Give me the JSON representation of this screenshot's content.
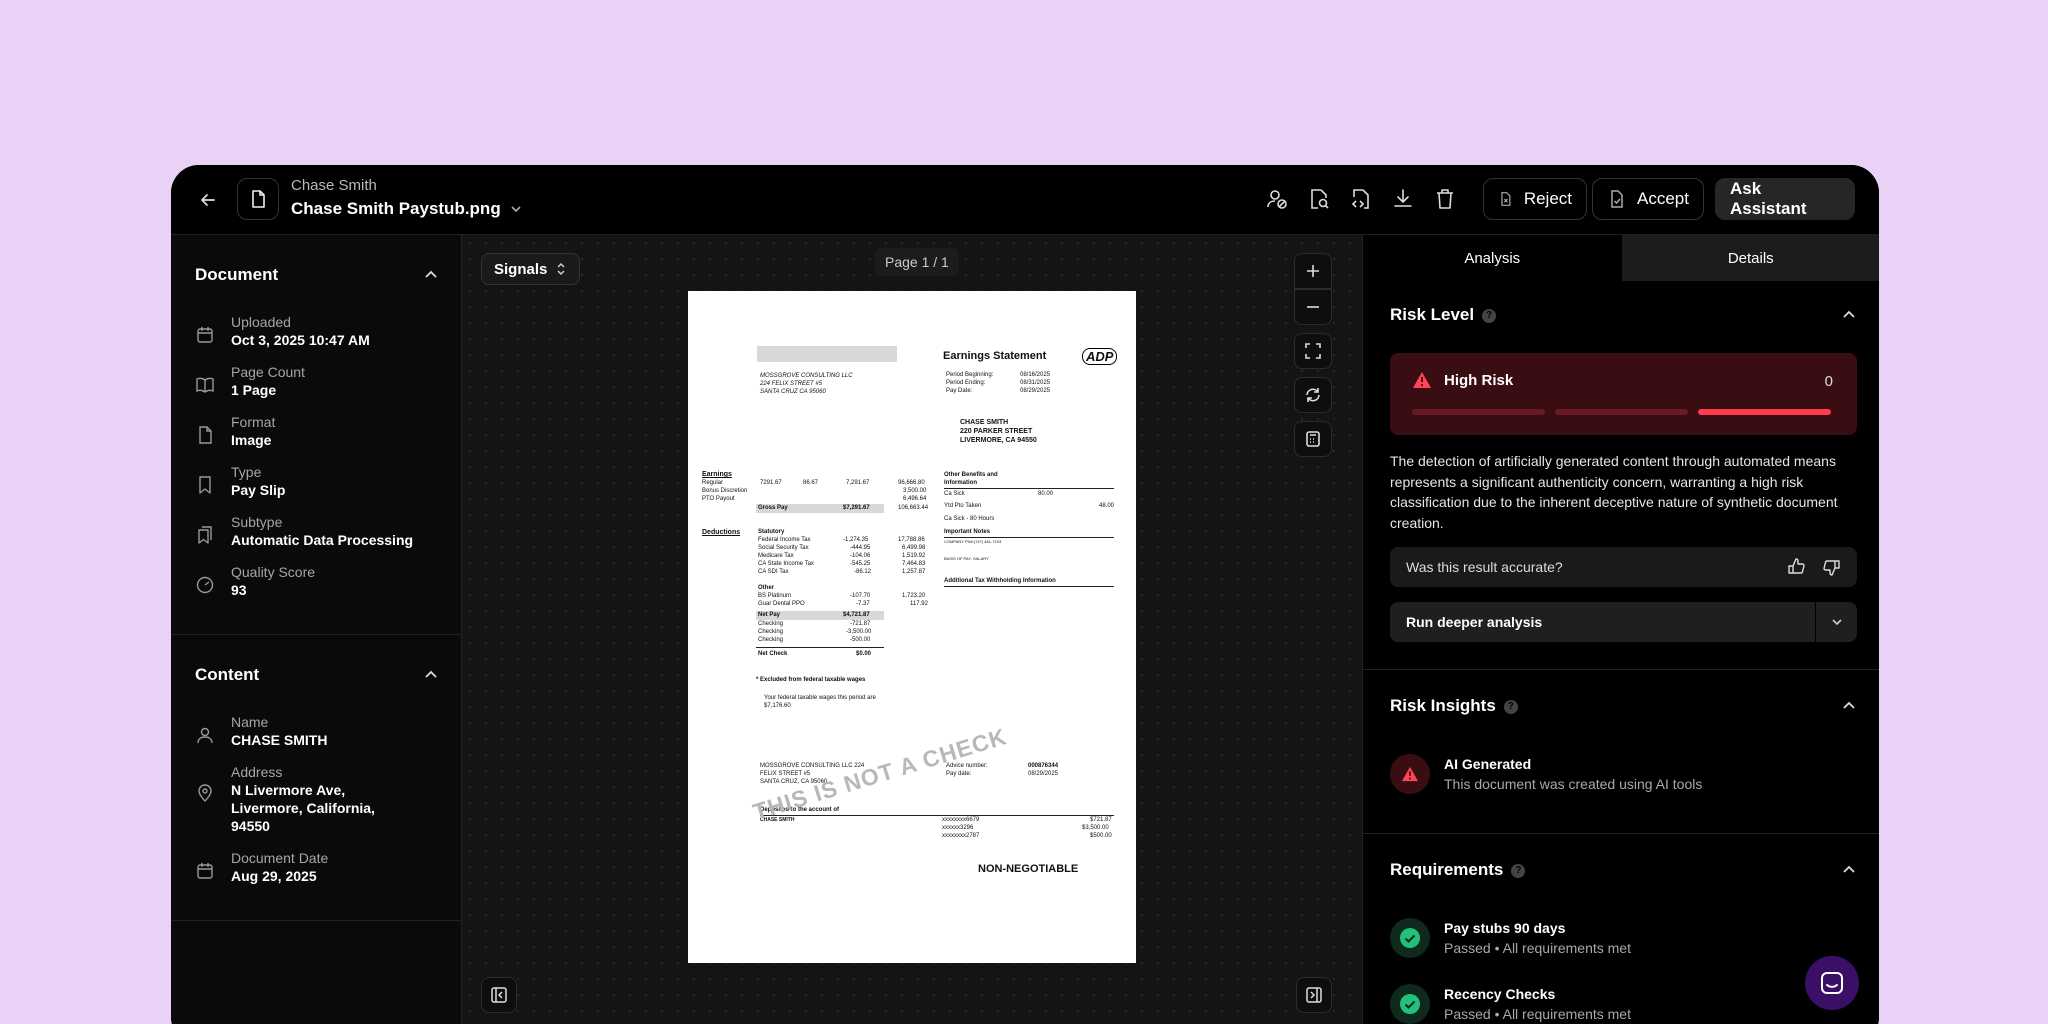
{
  "header": {
    "owner": "Chase Smith",
    "filename": "Chase Smith Paystub.png",
    "reject_label": "Reject",
    "accept_label": "Accept",
    "ask_label": "Ask Assistant"
  },
  "sidebar": {
    "document_title": "Document",
    "document_items": [
      {
        "label": "Uploaded",
        "value": "Oct 3, 2025 10:47 AM",
        "icon": "calendar-icon"
      },
      {
        "label": "Page Count",
        "value": "1 Page",
        "icon": "book-icon"
      },
      {
        "label": "Format",
        "value": "Image",
        "icon": "file-icon"
      },
      {
        "label": "Type",
        "value": "Pay Slip",
        "icon": "bookmark-icon"
      },
      {
        "label": "Subtype",
        "value": "Automatic Data Processing",
        "icon": "bookmarks-icon"
      },
      {
        "label": "Quality Score",
        "value": "93",
        "icon": "gauge-icon"
      }
    ],
    "content_title": "Content",
    "content_items": [
      {
        "label": "Name",
        "value": "CHASE SMITH",
        "icon": "user-icon"
      },
      {
        "label": "Address",
        "value": "N Livermore Ave, Livermore, California, 94550",
        "icon": "location-icon"
      },
      {
        "label": "Document Date",
        "value": "Aug 29, 2025",
        "icon": "calendar-icon"
      }
    ]
  },
  "viewer": {
    "signals_label": "Signals",
    "page_indicator": "Page 1 / 1"
  },
  "paper": {
    "title": "Earnings Statement",
    "logo": "ADP",
    "company": "MOSSGROVE  CONSULTING  LLC",
    "company_addr1": "224 FELIX  STREET  #5",
    "company_addr2": "SANTA  CRUZ  CA 95060",
    "period_begin_label": "Period Beginning:",
    "period_begin": "08/16/2025",
    "period_end_label": "Period Ending:",
    "period_end": "08/31/2025",
    "pay_date_label": "Pay Date:",
    "pay_date": "08/29/2025",
    "emp_name": "CHASE  SMITH",
    "emp_addr1": "220  PARKER  STREET",
    "emp_addr2": "LIVERMORE,  CA  94550",
    "earnings": "Earnings",
    "regular": "Regular",
    "regular_rate": "7291.67",
    "regular_hours": "86.67",
    "regular_amt": "7,291.67",
    "bonus": "Bonus Discretion",
    "pto": "PTO Payout",
    "ytd1": "96,666.80",
    "ytd2": "3,500.00",
    "ytd3": "6,496.64",
    "gross_pay": "Gross Pay",
    "gross_amt": "$7,291.67",
    "gross_ytd": "106,663.44",
    "deductions": "Deductions",
    "statutory": "Statutory",
    "fed_tax": "Federal Income Tax",
    "fed_amt": "-1,274.35",
    "fed_ytd": "17,788.86",
    "ss_tax": "Social Security Tax",
    "ss_amt": "-444.95",
    "ss_ytd": "6,499.98",
    "med_tax": "Medicare Tax",
    "med_amt": "-104.06",
    "med_ytd": "1,519.92",
    "ca_tax": "CA State Income Tax",
    "ca_amt": "-545.25",
    "ca_ytd": "7,464.83",
    "sdi_tax": "CA SDI Tax",
    "sdi_amt": "-86.12",
    "sdi_ytd": "1,257.87",
    "other": "Other",
    "bs": "BS Platinum",
    "bs_amt": "-107.70",
    "bs_ytd": "1,723.20",
    "dental": "Guar Dental PPO",
    "dental_amt": "-7.37",
    "dental_ytd": "117.92",
    "net_pay": "Net Pay",
    "net_amt": "$4,721.87",
    "checking": "Checking",
    "chk1": "-721.87",
    "chk2": "-3,500.00",
    "chk3": "-500.00",
    "net_check": "Net Check",
    "net_check_amt": "$0.00",
    "other_benefits": "Other  Benefits  and",
    "information": "Information",
    "ca_sick": "Ca Sick",
    "ca_sick_val": "80.00",
    "ytd_pto": "Ytd Pto Taken",
    "ytd_pto_val": "48.00",
    "ca_sick_hours": "Ca Sick - 80 Hours",
    "important_notes": "Important  Notes",
    "company_ph": "COMPANY  PH#:(747)  481-7103",
    "basis": "BASIS OF PAY: SALARY",
    "addl_tax": "Additional  Tax  Withholding  Information",
    "excluded": "*  Excluded  from  federal  taxable  wages",
    "taxable_wages1": "Your  federal  taxable  wages  this  period  are",
    "taxable_wages2": "$7,176.60",
    "stub_company1": "MOSSGROVE CONSULTING LLC  224",
    "stub_company2": "FELIX STREET #5",
    "stub_company3": "SANTA CRUZ, CA 95060",
    "advice_label": "Advice  number:",
    "advice_number": "000876344",
    "stub_paydate_label": "Pay  date:",
    "stub_paydate": "08/29/2025",
    "deposited": "Deposited   to  the  account   of",
    "stub_name": "CHASE   SMITH",
    "acct1": "xxxxxxxx6679",
    "acct2": "xxxxxx3296",
    "acct3": "xxxxxxxx2787",
    "amt1": "$721.87",
    "amt2": "$3,500.00",
    "amt3": "$500.00",
    "non_negotiable": "NON-NEGOTIABLE",
    "watermark": "THIS IS NOT A CHECK"
  },
  "analysis": {
    "tab_analysis": "Analysis",
    "tab_details": "Details",
    "risk_level_title": "Risk Level",
    "risk_label": "High Risk",
    "risk_score": "0",
    "risk_bar_level": 3,
    "risk_color": "#ff3b4e",
    "risk_description": "The detection of artificially generated content through automated means represents a significant authenticity concern, warranting a high risk classification due to the inherent deceptive nature of synthetic document creation.",
    "feedback_question": "Was this result accurate?",
    "deeper_label": "Run deeper analysis",
    "insights_title": "Risk Insights",
    "insight_title": "AI Generated",
    "insight_sub": "This document was created using AI tools",
    "requirements_title": "Requirements",
    "requirements": [
      {
        "title": "Pay stubs 90 days",
        "sub": "Passed • All requirements met"
      },
      {
        "title": "Recency Checks",
        "sub": "Passed • All requirements met"
      }
    ]
  }
}
